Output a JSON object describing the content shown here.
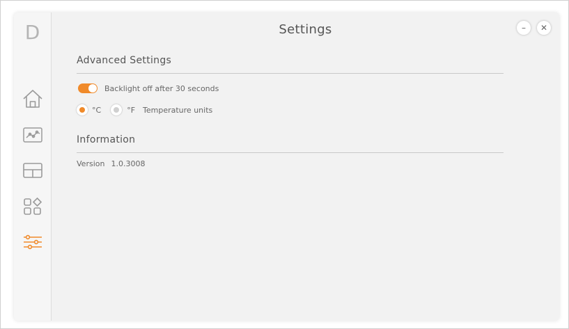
{
  "app": {
    "logo": "D",
    "title": "Settings"
  },
  "window_controls": {
    "minimize": "–",
    "close": "✕"
  },
  "sidebar": {
    "items": [
      {
        "icon": "home-icon"
      },
      {
        "icon": "chart-icon"
      },
      {
        "icon": "layout-icon"
      },
      {
        "icon": "apps-icon"
      },
      {
        "icon": "sliders-icon",
        "active": true
      }
    ]
  },
  "advanced": {
    "title": "Advanced Settings",
    "backlight_label": "Backlight off after 30 seconds",
    "backlight_enabled": true,
    "celsius_label": "°C",
    "fahrenheit_label": "°F",
    "temp_units_label": "Temperature units",
    "selected_unit": "°C"
  },
  "information": {
    "title": "Information",
    "version_label": "Version",
    "version_value": "1.0.3008"
  },
  "colors": {
    "accent": "#f08a2a",
    "icon": "#9a9a9a"
  }
}
